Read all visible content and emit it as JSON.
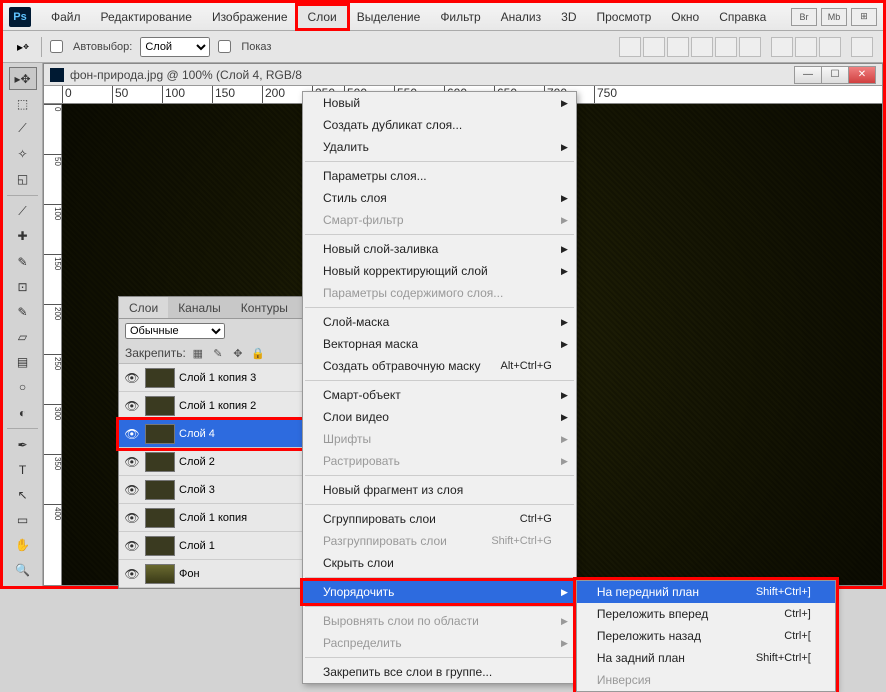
{
  "app": {
    "logo": "Ps"
  },
  "menubar": {
    "items": [
      "Файл",
      "Редактирование",
      "Изображение",
      "Слои",
      "Выделение",
      "Фильтр",
      "Анализ",
      "3D",
      "Просмотр",
      "Окно",
      "Справка"
    ],
    "active_index": 3,
    "right_buttons": [
      "Br",
      "Mb",
      "⊞"
    ]
  },
  "optionbar": {
    "autoselect_label": "Автовыбор:",
    "autoselect_value": "Слой",
    "show_label": "Показ"
  },
  "document": {
    "title": "фон-природа.jpg @ 100% (Слой 4, RGB/8"
  },
  "ruler": {
    "h_ticks": [
      "0",
      "50",
      "100",
      "150",
      "200",
      "250",
      "500",
      "550",
      "600",
      "650",
      "700",
      "750"
    ],
    "v_ticks": [
      "0",
      "50",
      "100",
      "150",
      "200",
      "250",
      "300",
      "350",
      "400"
    ]
  },
  "layers_panel": {
    "tabs": [
      "Слои",
      "Каналы",
      "Контуры"
    ],
    "active_tab": 0,
    "blend_mode": "Обычные",
    "lock_label": "Закрепить:",
    "layers": [
      {
        "name": "Слой 1 копия 3",
        "selected": false
      },
      {
        "name": "Слой 1 копия 2",
        "selected": false
      },
      {
        "name": "Слой 4",
        "selected": true
      },
      {
        "name": "Слой 2",
        "selected": false
      },
      {
        "name": "Слой 3",
        "selected": false
      },
      {
        "name": "Слой 1 копия",
        "selected": false
      },
      {
        "name": "Слой 1",
        "selected": false
      },
      {
        "name": "Фон",
        "selected": false,
        "bg": true
      }
    ]
  },
  "layer_menu": {
    "groups": [
      [
        {
          "t": "Новый",
          "sub": true
        },
        {
          "t": "Создать дубликат слоя..."
        },
        {
          "t": "Удалить",
          "sub": true
        }
      ],
      [
        {
          "t": "Параметры слоя..."
        },
        {
          "t": "Стиль слоя",
          "sub": true
        },
        {
          "t": "Смарт-фильтр",
          "sub": true,
          "disabled": true
        }
      ],
      [
        {
          "t": "Новый слой-заливка",
          "sub": true
        },
        {
          "t": "Новый корректирующий слой",
          "sub": true
        },
        {
          "t": "Параметры содержимого слоя...",
          "disabled": true
        }
      ],
      [
        {
          "t": "Слой-маска",
          "sub": true
        },
        {
          "t": "Векторная маска",
          "sub": true
        },
        {
          "t": "Создать обтравочную маску",
          "sc": "Alt+Ctrl+G"
        }
      ],
      [
        {
          "t": "Смарт-объект",
          "sub": true
        },
        {
          "t": "Слои видео",
          "sub": true
        },
        {
          "t": "Шрифты",
          "sub": true,
          "disabled": true
        },
        {
          "t": "Растрировать",
          "sub": true,
          "disabled": true
        }
      ],
      [
        {
          "t": "Новый фрагмент из слоя"
        }
      ],
      [
        {
          "t": "Сгруппировать слои",
          "sc": "Ctrl+G"
        },
        {
          "t": "Разгруппировать слои",
          "sc": "Shift+Ctrl+G",
          "disabled": true
        },
        {
          "t": "Скрыть слои"
        }
      ],
      [
        {
          "t": "Упорядочить",
          "sub": true,
          "selected": true
        }
      ],
      [
        {
          "t": "Выровнять слои по области",
          "sub": true,
          "disabled": true
        },
        {
          "t": "Распределить",
          "sub": true,
          "disabled": true
        }
      ],
      [
        {
          "t": "Закрепить все слои в группе..."
        }
      ]
    ]
  },
  "arrange_submenu": {
    "items": [
      {
        "t": "На передний план",
        "sc": "Shift+Ctrl+]",
        "selected": true
      },
      {
        "t": "Переложить вперед",
        "sc": "Ctrl+]"
      },
      {
        "t": "Переложить назад",
        "sc": "Ctrl+["
      },
      {
        "t": "На задний план",
        "sc": "Shift+Ctrl+["
      },
      {
        "t": "Инверсия",
        "disabled": true
      }
    ]
  },
  "tools": [
    "move",
    "marquee",
    "lasso",
    "wand",
    "crop",
    "eyedrop",
    "heal",
    "brush",
    "stamp",
    "history",
    "eraser",
    "gradient",
    "blur",
    "dodge",
    "pen",
    "type",
    "path",
    "shape",
    "hand",
    "zoom"
  ]
}
